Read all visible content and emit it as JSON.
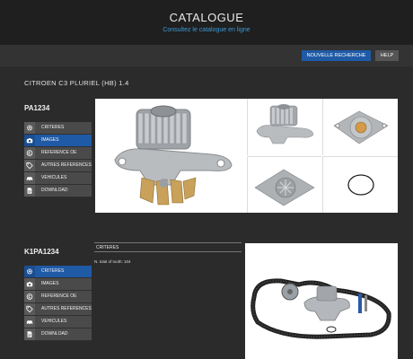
{
  "header": {
    "title": "CATALOGUE",
    "subtitle": "Consultez le catalogue en ligne"
  },
  "toolbar": {
    "new_search": "NOUVELLE RECHERCHE",
    "help": "HELP"
  },
  "vehicle": "CITROEN C3 PLURIEL (HB) 1.4",
  "products": [
    {
      "ref": "PA1234",
      "menu": [
        "CRITERES",
        "IMAGES",
        "REFERENCE OE",
        "AUTRES REFERENCES",
        "VEHICULES",
        "DOWNLOAD"
      ],
      "active": 1
    },
    {
      "ref": "K1PA1234",
      "menu": [
        "CRITERES",
        "IMAGES",
        "REFERENCE OE",
        "AUTRES REFERENCES",
        "VEHICULES",
        "DOWNLOAD"
      ],
      "active": 0,
      "criteria_header": "CRITERES",
      "criteria_text": "N. total of tooth: 104"
    }
  ],
  "colors": {
    "accent": "#1f5aa6",
    "link": "#3a9ad9",
    "background": "#2b2b2b"
  }
}
